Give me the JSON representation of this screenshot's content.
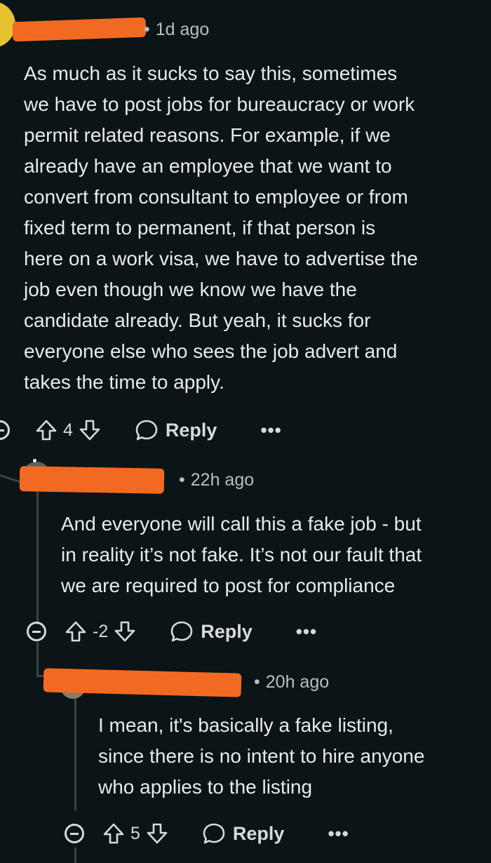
{
  "comments": [
    {
      "time": "1d ago",
      "body": "As much as it sucks to say this, sometimes\nwe have to post jobs for bureaucracy or work\npermit related reasons. For example, if we\nalready have an employee that we want to\nconvert from consultant to employee or from\nfixed term to permanent, if that person is\nhere on a work visa, we have to advertise the\njob even though we know we have the\ncandidate already. But yeah, it sucks for\neveryone else who sees the job advert and\ntakes the time to apply.",
      "votes": "4",
      "reply_label": "Reply",
      "more": "•••"
    },
    {
      "time": "22h ago",
      "body": "And everyone will call this a fake job - but\nin reality it’s not fake. It’s not our fault that\nwe are required to post for compliance",
      "votes": "-2",
      "reply_label": "Reply",
      "more": "•••"
    },
    {
      "time": "20h ago",
      "body": "I mean, it's basically a fake listing,\nsince there is no intent to hire anyone\nwho applies to the listing",
      "votes": "5",
      "reply_label": "Reply",
      "more": "•••"
    }
  ],
  "meta_separator": "•",
  "colors": {
    "background": "#0b1416",
    "redaction": "#f26a21",
    "text": "#e8eaeb",
    "meta": "#b8bfc3"
  },
  "icons": {
    "upvote": "arrow-up-outline-icon",
    "downvote": "arrow-down-outline-icon",
    "reply": "speech-bubble-icon",
    "collapse": "minus-circle-icon"
  }
}
